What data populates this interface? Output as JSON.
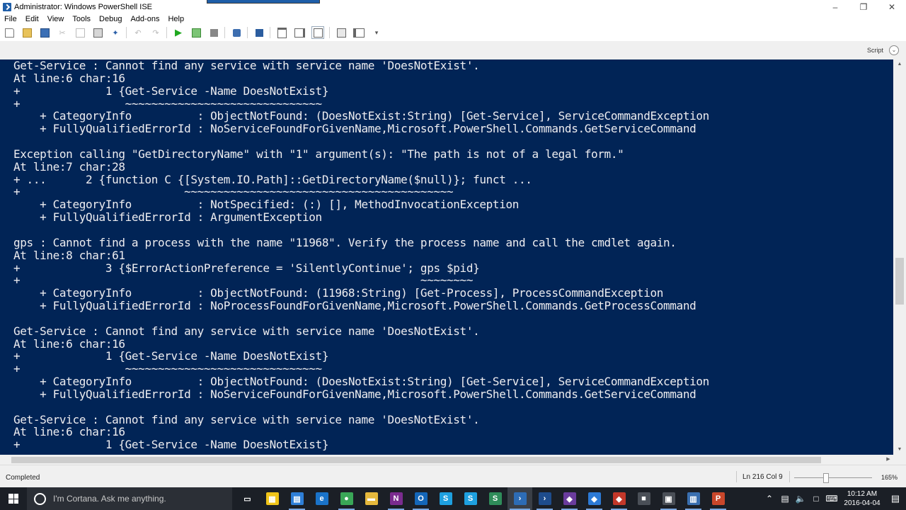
{
  "window": {
    "title": "Administrator: Windows PowerShell ISE"
  },
  "menu": [
    "File",
    "Edit",
    "View",
    "Tools",
    "Debug",
    "Add-ons",
    "Help"
  ],
  "toolbar_icons": [
    "new-file-icon",
    "open-folder-icon",
    "save-icon",
    "cut-icon",
    "copy-icon",
    "paste-icon",
    "clear-console-icon",
    "undo-icon",
    "redo-icon",
    "run-script-icon",
    "run-selection-icon",
    "stop-icon",
    "new-remote-tab-icon",
    "start-powershell-icon",
    "show-script-top-icon",
    "show-script-right-icon",
    "show-script-max-icon",
    "show-command-icon",
    "show-addon-icon"
  ],
  "script_pane": {
    "label": "Script"
  },
  "console": {
    "lines": [
      "Get-Service : Cannot find any service with service name 'DoesNotExist'.",
      "At line:6 char:16",
      "+             1 {Get-Service -Name DoesNotExist}",
      "+                ~~~~~~~~~~~~~~~~~~~~~~~~~~~~~~",
      "    + CategoryInfo          : ObjectNotFound: (DoesNotExist:String) [Get-Service], ServiceCommandException",
      "    + FullyQualifiedErrorId : NoServiceFoundForGivenName,Microsoft.PowerShell.Commands.GetServiceCommand",
      "",
      "Exception calling \"GetDirectoryName\" with \"1\" argument(s): \"The path is not of a legal form.\"",
      "At line:7 char:28",
      "+ ...      2 {function C {[System.IO.Path]::GetDirectoryName($null)}; funct ...",
      "+                         ~~~~~~~~~~~~~~~~~~~~~~~~~~~~~~~~~~~~~~~~~",
      "    + CategoryInfo          : NotSpecified: (:) [], MethodInvocationException",
      "    + FullyQualifiedErrorId : ArgumentException",
      "",
      "gps : Cannot find a process with the name \"11968\". Verify the process name and call the cmdlet again.",
      "At line:8 char:61",
      "+             3 {$ErrorActionPreference = 'SilentlyContinue'; gps $pid}",
      "+                                                             ~~~~~~~~",
      "    + CategoryInfo          : ObjectNotFound: (11968:String) [Get-Process], ProcessCommandException",
      "    + FullyQualifiedErrorId : NoProcessFoundForGivenName,Microsoft.PowerShell.Commands.GetProcessCommand",
      "",
      "Get-Service : Cannot find any service with service name 'DoesNotExist'.",
      "At line:6 char:16",
      "+             1 {Get-Service -Name DoesNotExist}",
      "+                ~~~~~~~~~~~~~~~~~~~~~~~~~~~~~~",
      "    + CategoryInfo          : ObjectNotFound: (DoesNotExist:String) [Get-Service], ServiceCommandException",
      "    + FullyQualifiedErrorId : NoServiceFoundForGivenName,Microsoft.PowerShell.Commands.GetServiceCommand",
      "",
      "Get-Service : Cannot find any service with service name 'DoesNotExist'.",
      "At line:6 char:16",
      "+             1 {Get-Service -Name DoesNotExist}"
    ],
    "background": "#012456",
    "foreground": "#eeedf0"
  },
  "status": {
    "text": "Completed",
    "position": "Ln 216  Col 9",
    "zoom": "165%"
  },
  "taskbar": {
    "search_placeholder": "I'm Cortana. Ask me anything.",
    "apps": [
      {
        "name": "task-view-icon",
        "color": "#1b1f26",
        "glyph": "▭"
      },
      {
        "name": "calculator-icon",
        "color": "#f0c419",
        "glyph": "▦"
      },
      {
        "name": "file-explorer-icon",
        "color": "#2e7fd8",
        "glyph": "▤"
      },
      {
        "name": "edge-icon",
        "color": "#1a73c9",
        "glyph": "e"
      },
      {
        "name": "chrome-icon",
        "color": "#3aa757",
        "glyph": "●"
      },
      {
        "name": "folder-icon",
        "color": "#e6b83c",
        "glyph": "▬"
      },
      {
        "name": "onenote-icon",
        "color": "#7b2c8f",
        "glyph": "N"
      },
      {
        "name": "outlook-icon",
        "color": "#1466b8",
        "glyph": "O"
      },
      {
        "name": "skype-icon",
        "color": "#1ea0e0",
        "glyph": "S"
      },
      {
        "name": "skype-business-icon",
        "color": "#1ea0e0",
        "glyph": "S"
      },
      {
        "name": "sway-icon",
        "color": "#2f8c5a",
        "glyph": "S"
      },
      {
        "name": "powershell-ise-icon",
        "color": "#2d6cb5",
        "glyph": "›"
      },
      {
        "name": "powershell-icon",
        "color": "#1e4c8c",
        "glyph": "›"
      },
      {
        "name": "visual-studio-icon",
        "color": "#6a3c9d",
        "glyph": "◆"
      },
      {
        "name": "vscode-icon",
        "color": "#2c7ad6",
        "glyph": "◆"
      },
      {
        "name": "git-icon",
        "color": "#c3382a",
        "glyph": "◆"
      },
      {
        "name": "camera-icon",
        "color": "#4a4f57",
        "glyph": "■"
      },
      {
        "name": "terminal-icon",
        "color": "#4a4f57",
        "glyph": "▣"
      },
      {
        "name": "network-icon",
        "color": "#3a6fb0",
        "glyph": "▥"
      },
      {
        "name": "powerpoint-icon",
        "color": "#c9472b",
        "glyph": "P"
      }
    ],
    "clock_time": "10:12 AM",
    "clock_date": "2016-04-04"
  }
}
